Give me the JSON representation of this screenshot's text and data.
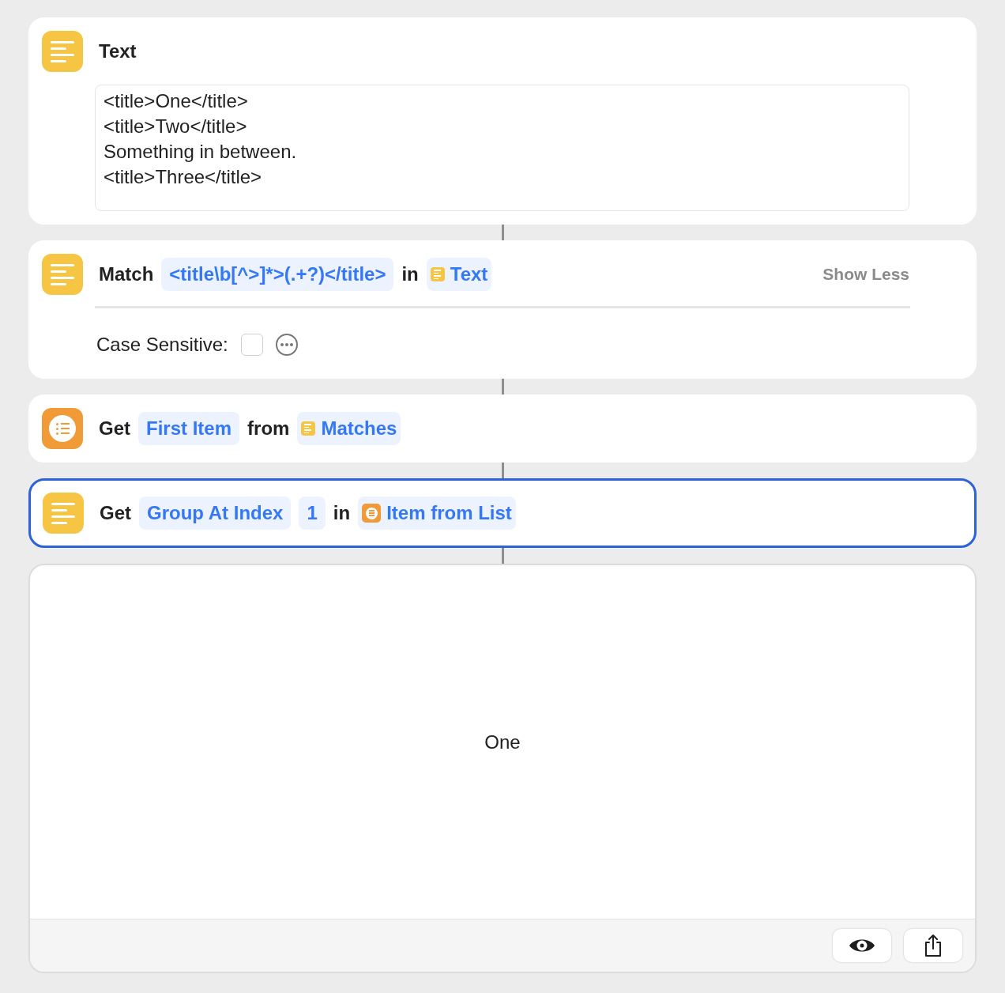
{
  "actions": [
    {
      "kind": "text",
      "selected": false,
      "parts": [
        {
          "kind": "word",
          "text": "Text"
        }
      ],
      "field_lines": [
        "<title>One</title>",
        "<title>Two</title>",
        "Something in between.",
        "<title>Three</title>"
      ]
    },
    {
      "kind": "text",
      "selected": false,
      "parts": [
        {
          "kind": "word",
          "text": "Match"
        },
        {
          "kind": "token",
          "text": "<title\\b[^>]*>(.+?)</title>"
        },
        {
          "kind": "word",
          "text": "in"
        },
        {
          "kind": "text-variable",
          "text": "Text"
        }
      ],
      "toggle": "Show Less",
      "options": [
        {
          "label": "Case Sensitive:",
          "checked": false
        }
      ]
    },
    {
      "kind": "list",
      "selected": false,
      "parts": [
        {
          "kind": "word",
          "text": "Get"
        },
        {
          "kind": "token",
          "text": "First Item"
        },
        {
          "kind": "word",
          "text": "from"
        },
        {
          "kind": "text-variable",
          "text": "Matches"
        }
      ]
    },
    {
      "kind": "text",
      "selected": true,
      "parts": [
        {
          "kind": "word",
          "text": "Get"
        },
        {
          "kind": "token",
          "text": "Group At Index"
        },
        {
          "kind": "token",
          "text": "1"
        },
        {
          "kind": "word",
          "text": "in"
        },
        {
          "kind": "list-variable",
          "text": "Item from List"
        }
      ]
    }
  ],
  "result": {
    "text": "One"
  }
}
